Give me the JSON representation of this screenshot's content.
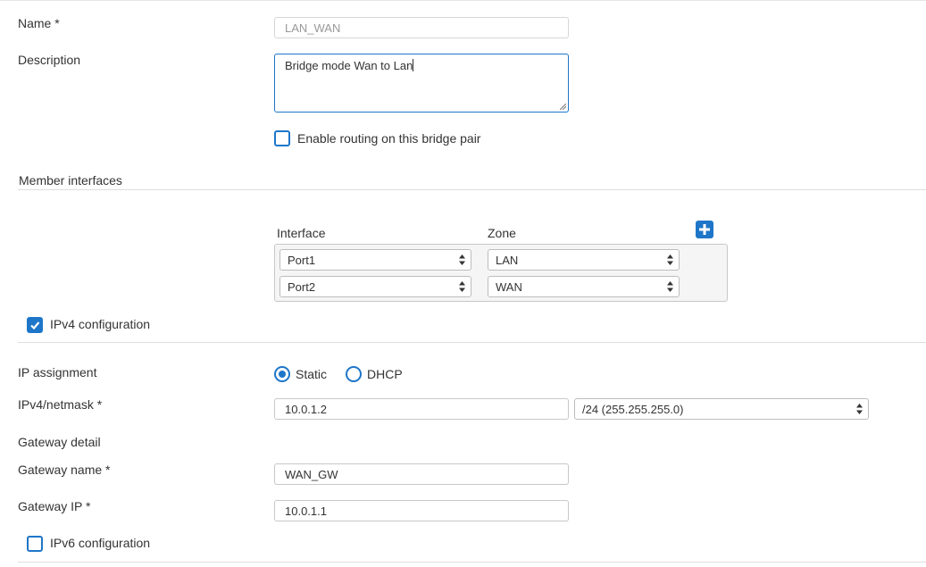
{
  "form": {
    "name_label": "Name *",
    "name_value": "LAN_WAN",
    "description_label": "Description",
    "description_value": "Bridge mode Wan to Lan",
    "enable_routing_label": "Enable routing on this bridge pair",
    "enable_routing_checked": false
  },
  "members": {
    "section_title": "Member interfaces",
    "interface_header": "Interface",
    "zone_header": "Zone",
    "add_icon": "plus-icon",
    "rows": [
      {
        "interface": "Port1",
        "zone": "LAN"
      },
      {
        "interface": "Port2",
        "zone": "WAN"
      }
    ]
  },
  "ipv4": {
    "section_label": "IPv4 configuration",
    "checked": true,
    "ip_assignment_label": "IP assignment",
    "static_label": "Static",
    "dhcp_label": "DHCP",
    "selected_assignment": "Static",
    "netmask_label": "IPv4/netmask *",
    "ip_value": "10.0.1.2",
    "netmask_value": "/24 (255.255.255.0)",
    "gateway_detail_label": "Gateway detail",
    "gateway_name_label": "Gateway name  *",
    "gateway_name_value": "WAN_GW",
    "gateway_ip_label": "Gateway IP  *",
    "gateway_ip_value": "10.0.1.1"
  },
  "ipv6": {
    "section_label": "IPv6 configuration",
    "checked": false
  },
  "colors": {
    "accent": "#1e76c9",
    "border": "#c8c8c8",
    "panel_bg": "#f5f5f5"
  }
}
